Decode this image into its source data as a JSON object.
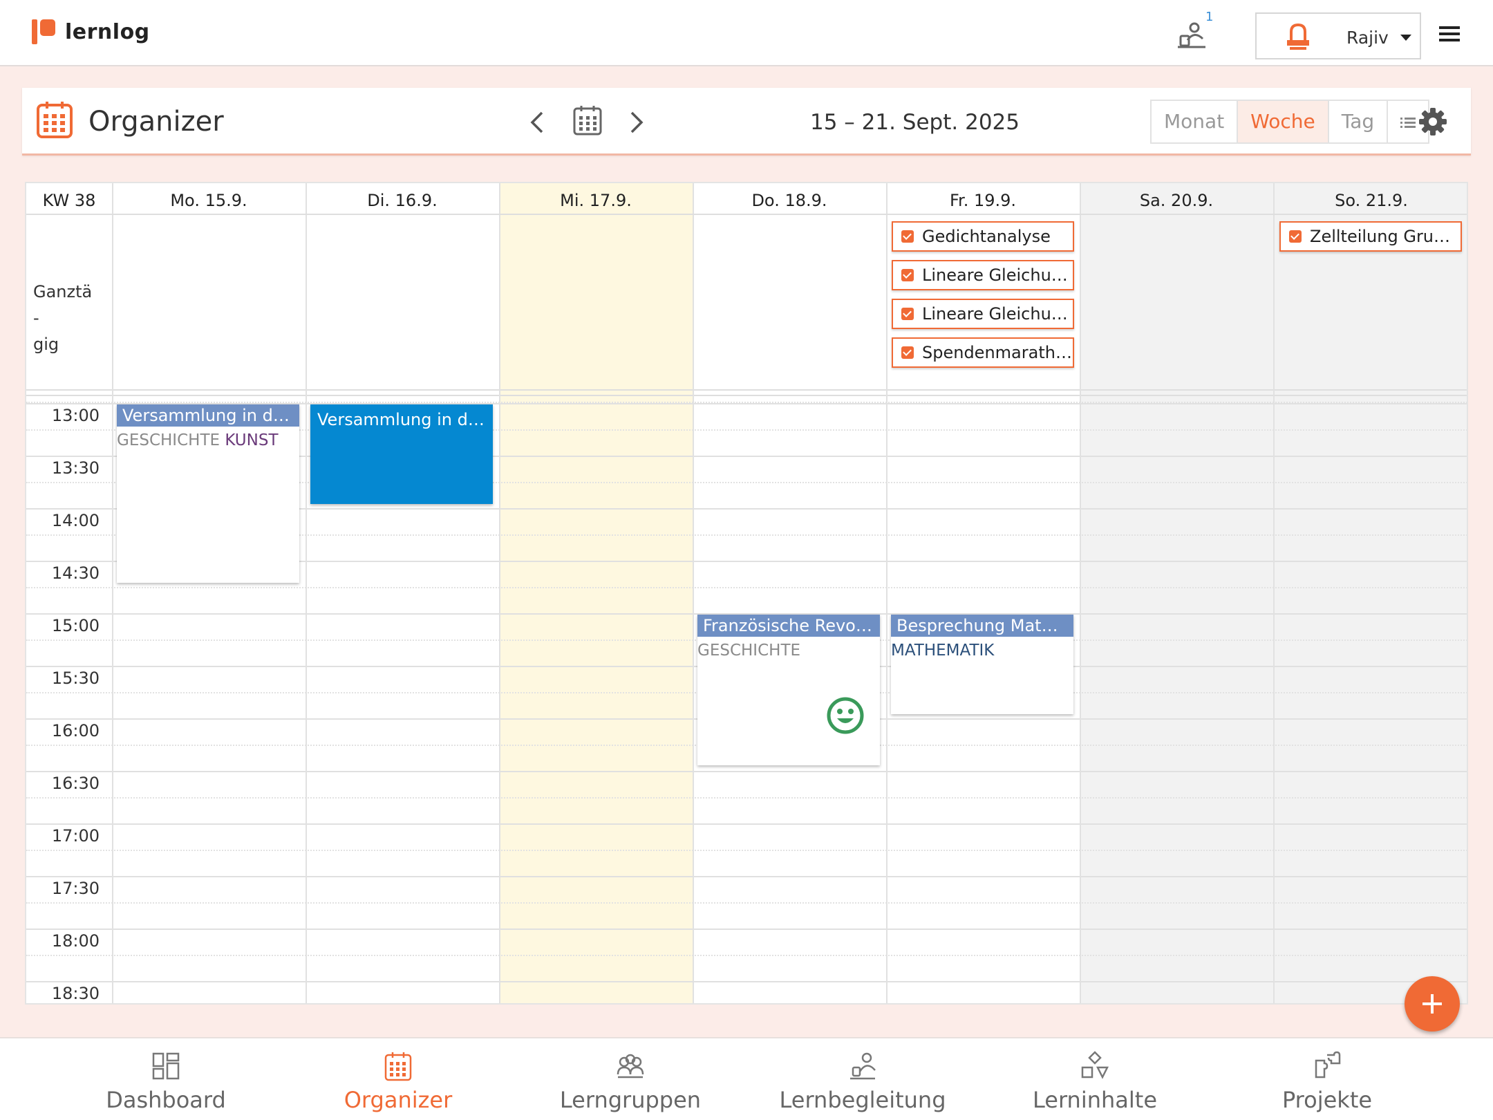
{
  "app": {
    "logo_text": "lernlog",
    "accent": "#f06a35"
  },
  "topbar": {
    "notification_count": "1",
    "user_name": "Rajiv"
  },
  "header": {
    "title": "Organizer",
    "date_range": "15 – 21. Sept. 2025",
    "views": [
      "Monat",
      "Woche",
      "Tag"
    ],
    "active_view": "Woche"
  },
  "calendar": {
    "week_label": "KW 38",
    "days": [
      "Mo. 15.9.",
      "Di. 16.9.",
      "Mi. 17.9.",
      "Do. 18.9.",
      "Fr. 19.9.",
      "Sa. 20.9.",
      "So. 21.9."
    ],
    "allday_label": "Ganztä -\ngig",
    "times": [
      "13:00",
      "13:30",
      "14:00",
      "14:30",
      "15:00",
      "15:30",
      "16:00",
      "16:30",
      "17:00",
      "17:30",
      "18:00",
      "18:30"
    ],
    "tasks": [
      {
        "day": 4,
        "slot": 0,
        "label": "Gedichtanalyse"
      },
      {
        "day": 4,
        "slot": 1,
        "label": "Lineare Gleichungen"
      },
      {
        "day": 4,
        "slot": 2,
        "label": "Lineare Gleichungen"
      },
      {
        "day": 4,
        "slot": 3,
        "label": "Spendenmarathon"
      },
      {
        "day": 6,
        "slot": 0,
        "label": "Zellteilung Grundlagen"
      }
    ],
    "events": [
      {
        "title": "Versammlung in der Aula",
        "tags": [
          [
            "GESCHICHTE",
            "grey"
          ],
          [
            "KUNST",
            "purple"
          ]
        ]
      },
      {
        "title": "Versammlung in der Aula"
      },
      {
        "title": "Französische Revolution",
        "tags": [
          [
            "GESCHICHTE",
            "grey"
          ]
        ],
        "mood_icon": "smiley-icon"
      },
      {
        "title": "Besprechung Mathe Projekt",
        "tags": [
          [
            "MATHEMATIK",
            "navy"
          ]
        ]
      }
    ]
  },
  "bottom_nav": [
    {
      "label": "Dashboard",
      "icon": "dashboard-icon"
    },
    {
      "label": "Organizer",
      "icon": "calendar-icon",
      "active": true
    },
    {
      "label": "Lerngruppen",
      "icon": "group-icon"
    },
    {
      "label": "Lernbegleitung",
      "icon": "mentoring-icon"
    },
    {
      "label": "Lerninhalte",
      "icon": "shapes-icon"
    },
    {
      "label": "Projekte",
      "icon": "puzzle-icon"
    }
  ]
}
